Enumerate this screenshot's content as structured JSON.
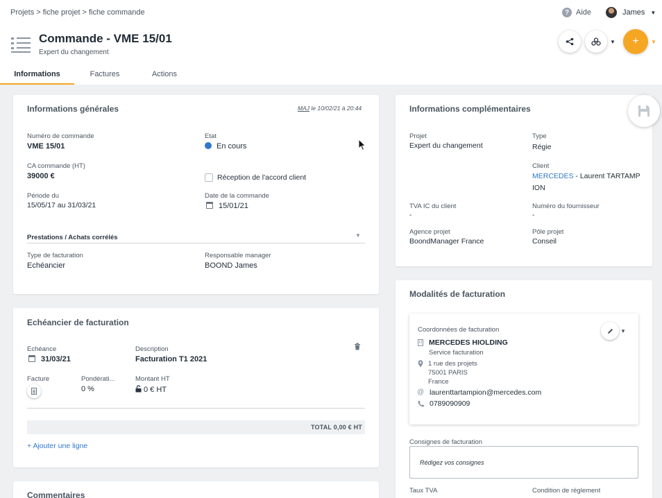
{
  "breadcrumb": {
    "items": [
      "Projets",
      "fiche projet",
      "fiche commande"
    ],
    "separator": ">"
  },
  "header": {
    "help_label": "Aide",
    "user_name": "James",
    "title": "Commande - VME 15/01",
    "subtitle": "Expert du changement",
    "add_symbol": "+"
  },
  "tabs": [
    {
      "label": "Informations",
      "active": true
    },
    {
      "label": "Factures",
      "active": false
    },
    {
      "label": "Actions",
      "active": false
    }
  ],
  "general": {
    "title": "Informations générales",
    "maj_prefix": "MAJ",
    "maj_text": " le 10/02/21 à 20:44",
    "order_number_label": "Numéro de commande",
    "order_number": "VME 15/01",
    "state_label": "Etat",
    "state_value": "En cours",
    "ca_label": "CA commande (HT)",
    "ca_value": "39000 €",
    "reception_label": "Réception de l'accord client",
    "period_label": "Période du",
    "period_value": "15/05/17 au 31/03/21",
    "order_date_label": "Date de la commande",
    "order_date_value": "15/01/21",
    "prestations_label": "Prestations / Achats corrélés",
    "billing_type_label": "Type de facturation",
    "billing_type_value": "Echéancier",
    "manager_label": "Responsable manager",
    "manager_value": "BOOND James"
  },
  "schedule": {
    "title": "Echéancier de facturation",
    "due_label": "Echéance",
    "due_value": "31/03/21",
    "description_label": "Description",
    "description_value": "Facturation T1 2021",
    "invoice_label": "Facture",
    "weight_label": "Pondérati...",
    "weight_value": "0 %",
    "amount_label": "Montant HT",
    "amount_value": "0 € HT",
    "total_text": "TOTAL  0,00 € HT",
    "add_line_label": "+ Ajouter une ligne"
  },
  "comments": {
    "title": "Commentaires"
  },
  "complementary": {
    "title": "Informations complémentaires",
    "project_label": "Projet",
    "project_value": "Expert du changement",
    "type_label": "Type",
    "type_value": "Régie",
    "client_label": "Client",
    "client_company": "MERCEDES",
    "client_contact_line1": " -  Laurent TARTAMP",
    "client_contact_line2": "ION",
    "tva_label": "TVA IC du client",
    "tva_value": "-",
    "supplier_label": "Numéro du fournisseur",
    "supplier_value": "-",
    "agency_label": "Agence projet",
    "agency_value": "BoondManager France",
    "pole_label": "Pôle projet",
    "pole_value": "Conseil"
  },
  "billing": {
    "title": "Modalités de facturation",
    "coords_label": "Coordonnées de facturation",
    "company": "MERCEDES HIOLDING",
    "service": "Service facturation",
    "address1": "1 rue des projets",
    "address2": "75001 PARIS",
    "country": "France",
    "email": "laurenttartampion@mercedes.com",
    "phone": "0789090909",
    "instructions_label": "Consignes de facturation",
    "instructions_placeholder": "Rédigez vos consignes",
    "tva_rate_label": "Taux TVA",
    "payment_condition_label": "Condition de règlement"
  },
  "colors": {
    "accent": "#f5a623",
    "link": "#2f77c9",
    "background": "#eef0f2"
  }
}
